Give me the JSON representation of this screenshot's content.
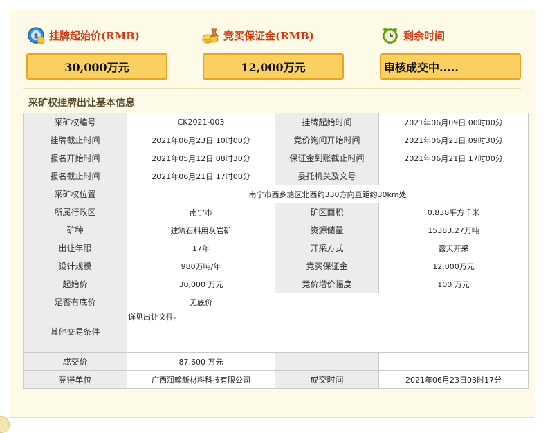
{
  "header": {
    "start_price": {
      "title": "挂牌起始价(RMB)",
      "value": "30,000万元",
      "icon": "money-coin-icon"
    },
    "deposit": {
      "title": "竞买保证金(RMB)",
      "value": "12,000万元",
      "icon": "coins-bag-icon"
    },
    "remaining": {
      "title": "剩余时间",
      "value": "审核成交中.....",
      "icon": "alarm-clock-icon"
    }
  },
  "section_title": "采矿权挂牌出让基本信息",
  "rows": [
    {
      "l1": "采矿权编号",
      "v1": "CK2021-003",
      "l2": "挂牌起始时间",
      "v2": "2021年06月09日 00时00分"
    },
    {
      "l1": "挂牌截止时间",
      "v1": "2021年06月23日 10时00分",
      "l2": "竞价询问开始时间",
      "v2": "2021年06月23日 09时30分"
    },
    {
      "l1": "报名开始时间",
      "v1": "2021年05月12日 08时30分",
      "l2": "保证金到账截止时间",
      "v2": "2021年06月21日 17时00分"
    },
    {
      "l1": "报名截止时间",
      "v1": "2021年06月21日 17时00分",
      "l2": "委托机关及文号",
      "v2": ""
    },
    {
      "l1": "采矿权位置",
      "v1": "南宁市西乡塘区北西约330方向直距约30km处"
    },
    {
      "l1": "所属行政区",
      "v1": "南宁市",
      "l2": "矿区面积",
      "v2": "0.838平方千米"
    },
    {
      "l1": "矿种",
      "v1": "建筑石料用灰岩矿",
      "l2": "资源储量",
      "v2": "15383.27万吨"
    },
    {
      "l1": "出让年限",
      "v1": "17年",
      "l2": "开采方式",
      "v2": "露天开采"
    },
    {
      "l1": "设计规模",
      "v1": "980万吨/年",
      "l2": "竞买保证金",
      "v2": "12,000万元"
    },
    {
      "l1": "起始价",
      "v1": "30,000 万元",
      "l2": "竞价增价幅度",
      "v2": "100 万元"
    },
    {
      "l1": "是否有底价",
      "v1": "无底价"
    },
    {
      "l1": "其他交易条件",
      "v1": "详见出让文件。"
    },
    {
      "l1": "成交价",
      "v1": "87,600 万元",
      "l2": "",
      "v2": ""
    },
    {
      "l1": "竞得单位",
      "v1": "广西润翰新材料科技有限公司",
      "l2": "成交时间",
      "v2": "2021年06月23日03时17分"
    }
  ]
}
